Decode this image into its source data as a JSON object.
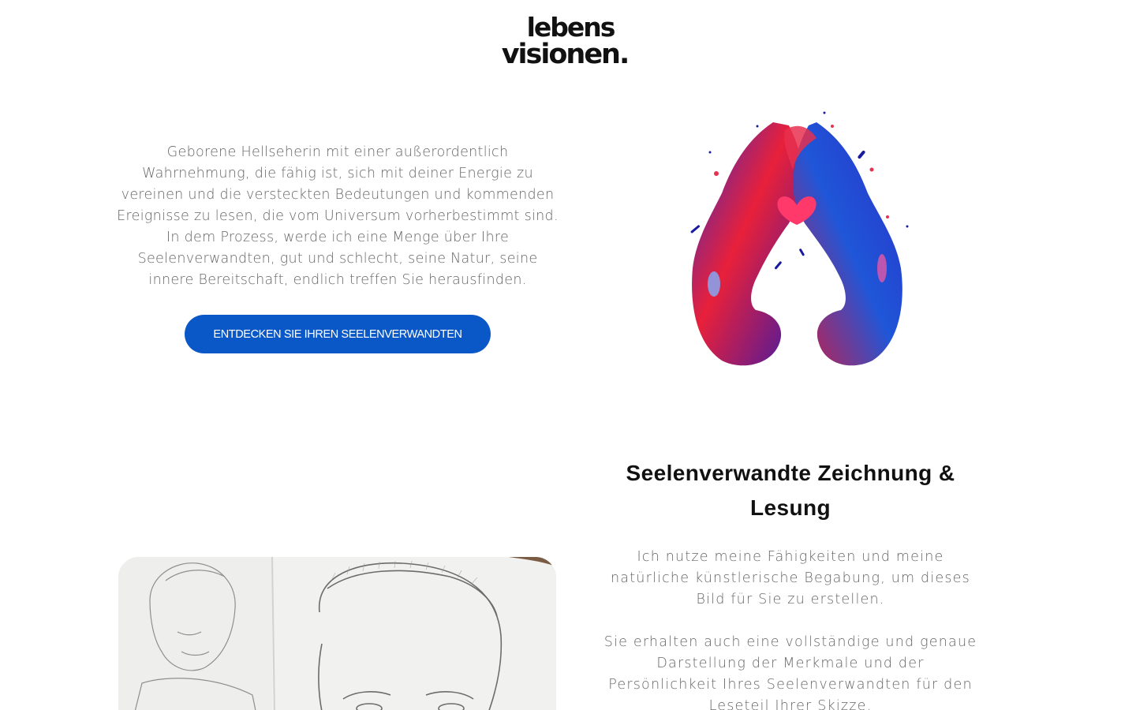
{
  "logo": {
    "line1": "lebens",
    "line2": "visionen."
  },
  "hero": {
    "text": "Geborene Hellseherin mit einer außerordentlich Wahrnehmung, die fähig ist, sich mit deiner Energie zu vereinen und die versteckten Bedeutungen und kommenden Ereignisse zu lesen, die vom Universum vorherbestimmt sind. In dem Prozess, werde ich eine Menge über Ihre Seelenverwandten, gut und schlecht, seine Natur, seine innere Bereitschaft, endlich treffen Sie herausfinden.",
    "cta_label": "ENTDECKEN SIE IHREN SEELENVERWANDTEN",
    "cta_color": "#0a58c8"
  },
  "section": {
    "title": "Seelenverwandte Zeichnung & Lesung",
    "paragraph1": "Ich nutze meine Fähigkeiten und meine natürliche künstlerische Begabung, um dieses Bild für Sie zu erstellen.",
    "paragraph2": "Sie erhalten auch eine vollständige und genaue Darstellung der Merkmale und der Persönlichkeit Ihres Seelenverwandten für den Leseteil Ihrer Skizze."
  },
  "icons": {
    "hands": "heart-hands-illustration",
    "sketch": "pencil-portrait-sketch"
  }
}
